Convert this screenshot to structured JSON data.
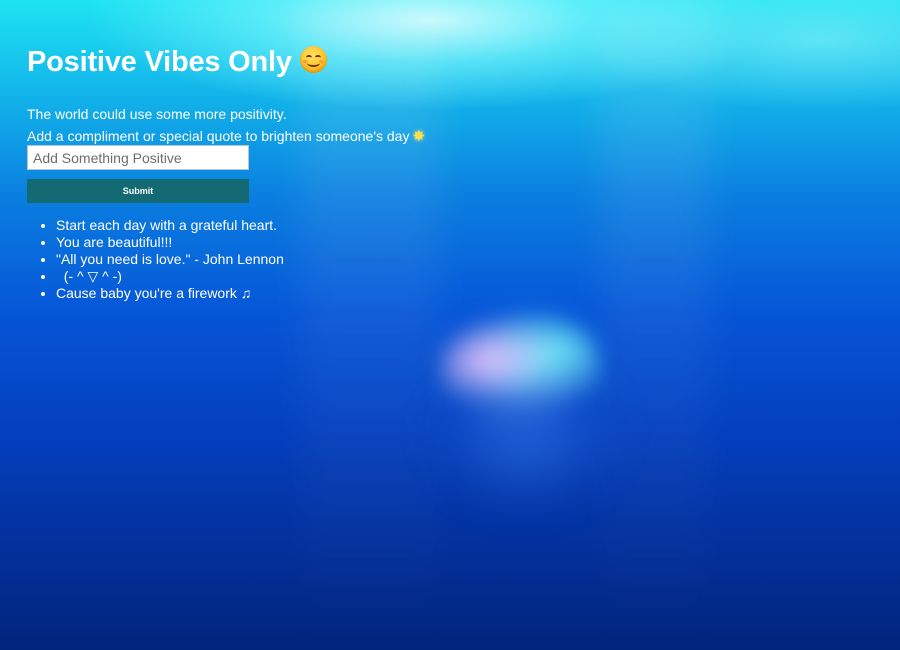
{
  "page": {
    "title": "Positive Vibes Only",
    "title_emoji": "smiling-face-emoji",
    "intro_line_1": "The world could use some more positivity.",
    "intro_line_2": "Add a compliment or special quote to brighten someone's day",
    "intro_line_2_emoji": "glowing-star-emoji"
  },
  "form": {
    "input_placeholder": "Add Something Positive",
    "input_value": "",
    "submit_label": "Submit"
  },
  "messages": [
    {
      "text": "Start each day with a grateful heart."
    },
    {
      "text": "You are beautiful!!!"
    },
    {
      "text": "\"All you need is love.\" - John Lennon"
    },
    {
      "text": "  (- ^ ▽ ^ -)"
    },
    {
      "text": "Cause baby you're a firework ♫"
    }
  ],
  "colors": {
    "button_bg": "#136a72",
    "text": "#ffffff",
    "background_top": "#1fe3f2",
    "background_bottom": "#02257c"
  }
}
